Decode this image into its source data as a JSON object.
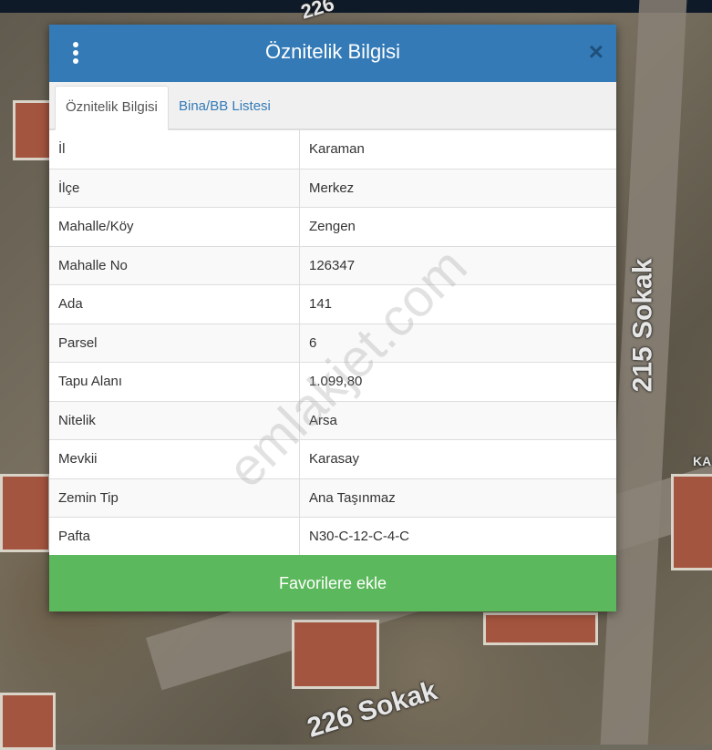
{
  "dialog": {
    "title": "Öznitelik Bilgisi",
    "close_symbol": "×",
    "tabs": [
      {
        "label": "Öznitelik Bilgisi"
      },
      {
        "label": "Bina/BB Listesi"
      }
    ],
    "rows": [
      {
        "key": "İl",
        "value": "Karaman"
      },
      {
        "key": "İlçe",
        "value": "Merkez"
      },
      {
        "key": "Mahalle/Köy",
        "value": "Zengen"
      },
      {
        "key": "Mahalle No",
        "value": "126347"
      },
      {
        "key": "Ada",
        "value": "141"
      },
      {
        "key": "Parsel",
        "value": "6"
      },
      {
        "key": "Tapu Alanı",
        "value": "1.099,80"
      },
      {
        "key": "Nitelik",
        "value": "Arsa"
      },
      {
        "key": "Mevkii",
        "value": "Karasay"
      },
      {
        "key": "Zemin Tip",
        "value": "Ana Taşınmaz"
      },
      {
        "key": "Pafta",
        "value": "N30-C-12-C-4-C"
      }
    ],
    "favorite_button": "Favorilere ekle"
  },
  "map": {
    "road_labels": [
      "215 Sokak",
      "226 Sokak",
      "226",
      "KA"
    ]
  },
  "watermark": "emlakjet.com",
  "icons": {
    "menu": "vertical-dots-icon",
    "close": "close-icon"
  },
  "colors": {
    "header": "#337ab7",
    "button": "#5cb85c"
  }
}
